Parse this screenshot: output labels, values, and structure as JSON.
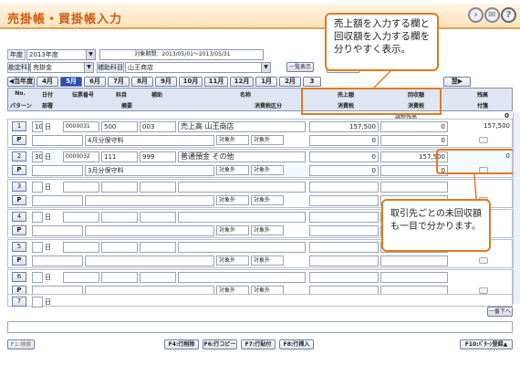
{
  "app": {
    "title": "売掛帳・買掛帳入力"
  },
  "filters": {
    "year_label": "年度",
    "year_value": "2013年度",
    "period_label": "対象期間：2013/05/01～2013/05/31",
    "account_label": "勘定科目",
    "account_value": "売掛金",
    "sub_label": "補助科目",
    "sub_value": "山王商店",
    "list_button": "一覧表示",
    "mini_value": "2013年度"
  },
  "months": {
    "prev": "◀当年度",
    "tabs": [
      "4月",
      "5月",
      "6月",
      "7月",
      "8月",
      "9月",
      "10月",
      "11月",
      "12月",
      "1月",
      "2月",
      "3"
    ],
    "selected_index": 1,
    "next": "翌▶"
  },
  "header": {
    "row1": [
      "No.",
      "日付",
      "伝票番号",
      "科目",
      "補助",
      "名称",
      "売上額",
      "回収額",
      "残高"
    ],
    "row2": [
      "パターン",
      "部署",
      "摘要",
      "消費税区分",
      "消費税",
      "消費税",
      "付箋"
    ],
    "extra": "課税残高"
  },
  "opening_balance": "0",
  "rows": [
    {
      "no": "1",
      "day": "10",
      "day_unit": "日",
      "voucher": "0000031",
      "dept_code": "500",
      "account": "003",
      "name": "売上高 山王商店",
      "memo": "4月分保守料",
      "tax1": "対象外",
      "tax2": "対象外",
      "sales": "157,500",
      "sales_tax": "0",
      "collect": "0",
      "collect_tax": "0",
      "balance": "157,500"
    },
    {
      "no": "2",
      "day": "30",
      "day_unit": "日",
      "voucher": "0000032",
      "dept_code": "111",
      "account": "999",
      "name": "普通預金 その他",
      "memo": "3月分保守料",
      "tax1": "対象外",
      "tax2": "対象外",
      "sales": "0",
      "sales_tax": "0",
      "collect": "157,500",
      "collect_tax": "0",
      "balance": "0"
    },
    {
      "no": "3",
      "day": "",
      "day_unit": "日",
      "tax1": "対象外",
      "tax2": "対象外"
    },
    {
      "no": "4",
      "day": "",
      "day_unit": "日",
      "tax1": "対象外",
      "tax2": "対象外"
    },
    {
      "no": "5",
      "day": "",
      "day_unit": "日",
      "tax1": "対象外",
      "tax2": "対象外"
    },
    {
      "no": "6",
      "day": "",
      "day_unit": "日",
      "tax1": "対象外",
      "tax2": "対象外"
    },
    {
      "no": "7",
      "day": "",
      "day_unit": "日"
    }
  ],
  "pattern_label": "P",
  "callouts": {
    "top": [
      "売上額を入力する欄と",
      "回収額を入力する欄を",
      "分りやすく表示。"
    ],
    "bottom": [
      "取引先ごとの未回収額",
      "も一目で分かります。"
    ]
  },
  "footer": {
    "fkeys": [
      "F1:検索",
      "F4:行削除",
      "F6:行コピー",
      "F7:行貼付",
      "F8:行挿入",
      "F10:ﾊﾟﾀｰﾝ登録▲"
    ],
    "page_down": "一番下へ"
  },
  "colors": {
    "accent": "#e07a1e",
    "title": "#d05a10",
    "tab_selected": "#2a4fb8"
  }
}
